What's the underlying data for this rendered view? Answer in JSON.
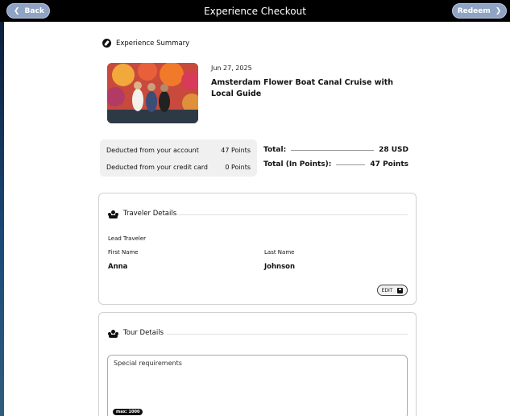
{
  "header": {
    "title": "Experience Checkout",
    "back_label": "Back",
    "redeem_label": "Redeem"
  },
  "summary": {
    "section_title": "Experience Summary",
    "date": "Jun 27, 2025",
    "experience_title": "Amsterdam Flower Boat Canal Cruise with Local Guide"
  },
  "payment": {
    "account_label": "Deducted from your account",
    "account_value": "47 Points",
    "card_label": "Deducted from your credit card",
    "card_value": "0 Points",
    "total_label": "Total:",
    "total_value": "28 USD",
    "total_points_label": "Total (In Points):",
    "total_points_value": "47 Points"
  },
  "traveler": {
    "section_title": "Traveler Details",
    "lead_label": "Lead Traveler",
    "first_name_label": "First Name",
    "first_name_value": "Anna",
    "last_name_label": "Last Name",
    "last_name_value": "Johnson",
    "edit_label": "EDIT"
  },
  "tour": {
    "section_title": "Tour Details",
    "requirements_placeholder": "Special requirements",
    "max_label": "max: 1000"
  },
  "colors": {
    "topbar": "#000000",
    "pill": "#8fa3c4"
  }
}
